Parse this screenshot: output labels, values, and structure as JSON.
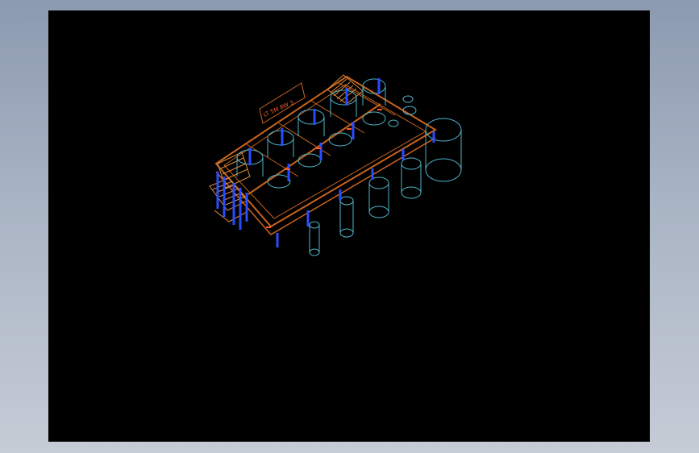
{
  "viewport": {
    "background": "#000000",
    "frame_gradient": [
      "#8c9ab0",
      "#c6ccd6"
    ]
  },
  "drawing": {
    "sign_label": "LT 5M 8W 3",
    "colors": {
      "frame": "#c8641e",
      "frame_light": "#e08a3c",
      "columns": "#2a4cff",
      "tanks": "#4fb3c8",
      "text": "#ff5a2a"
    }
  }
}
